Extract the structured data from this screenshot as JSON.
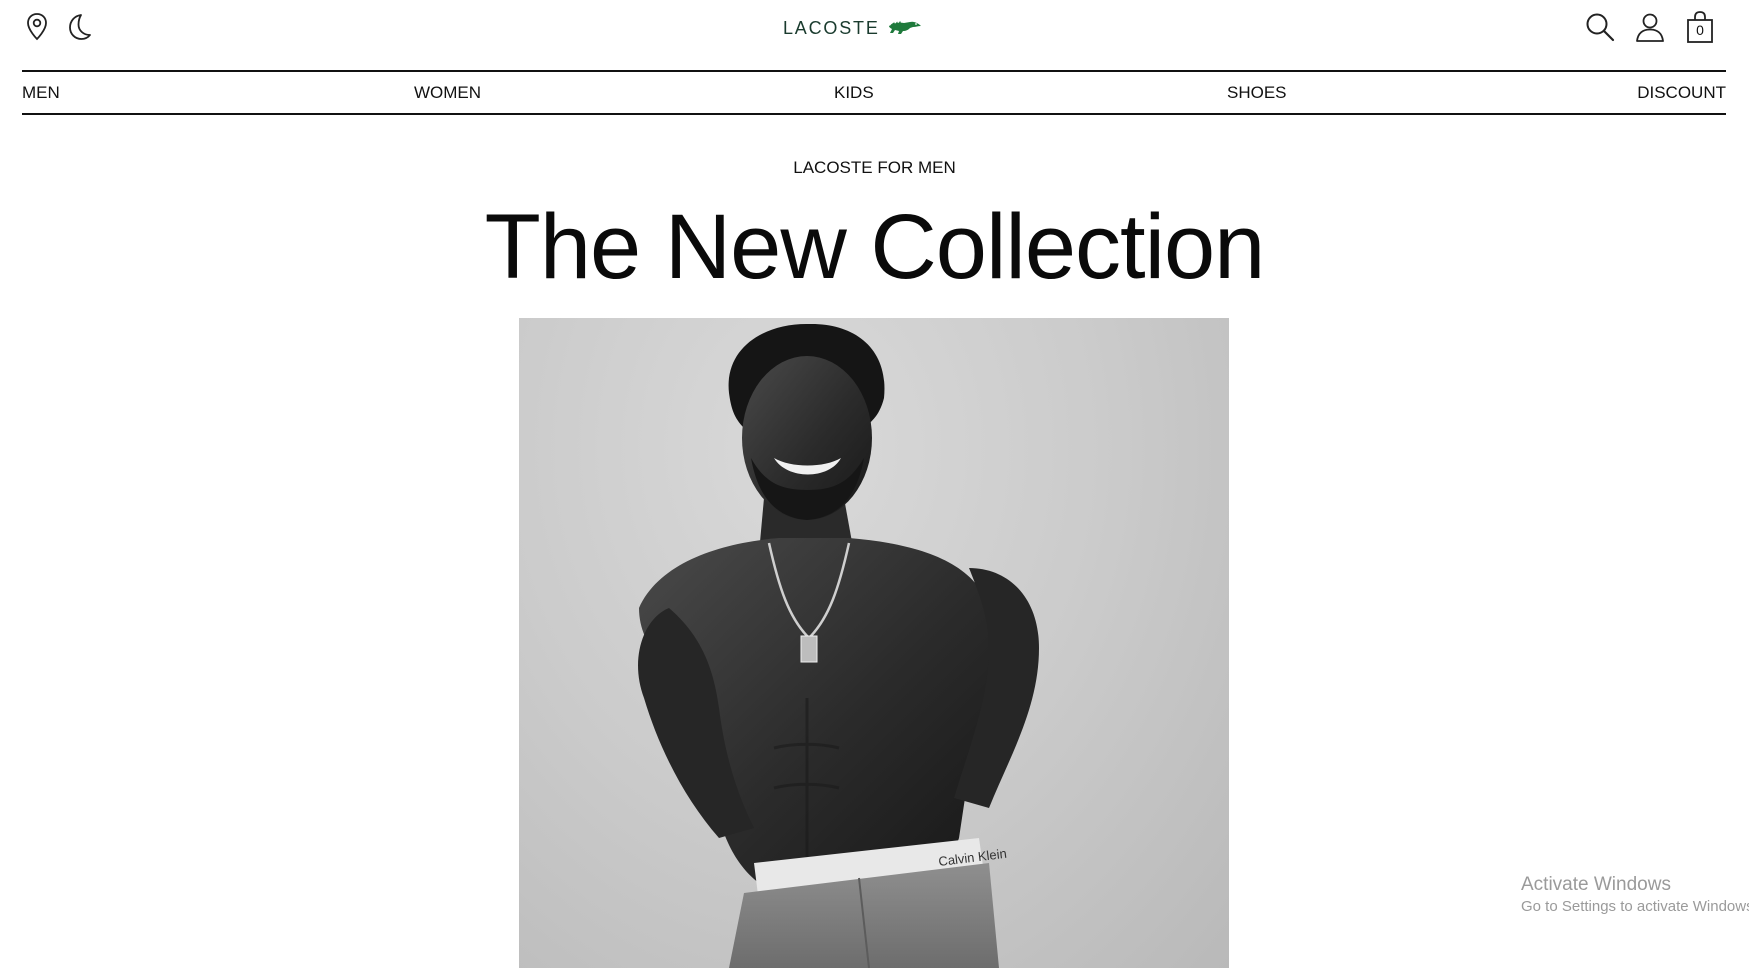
{
  "header": {
    "brand": "LACOSTE",
    "cart_count": "0",
    "icons": {
      "location": "location-pin-icon",
      "theme": "moon-icon",
      "search": "search-icon",
      "account": "user-icon",
      "cart": "shopping-bag-icon",
      "logo_mark": "crocodile-icon"
    },
    "brand_color": "#1a3b2e",
    "croc_color": "#1f7a3c"
  },
  "nav": {
    "items": [
      {
        "label": "MEN"
      },
      {
        "label": "WOMEN"
      },
      {
        "label": "KIDS"
      },
      {
        "label": "SHOES"
      },
      {
        "label": "DISCOUNT"
      }
    ]
  },
  "hero": {
    "eyebrow": "LACOSTE FOR MEN",
    "title": "The New Collection",
    "image_alt": "Black and white photo of a shirtless smiling male model in jeans",
    "waistband_text": "Calvin Klein"
  },
  "watermark": {
    "title": "Activate Windows",
    "subtitle": "Go to Settings to activate Windows."
  }
}
